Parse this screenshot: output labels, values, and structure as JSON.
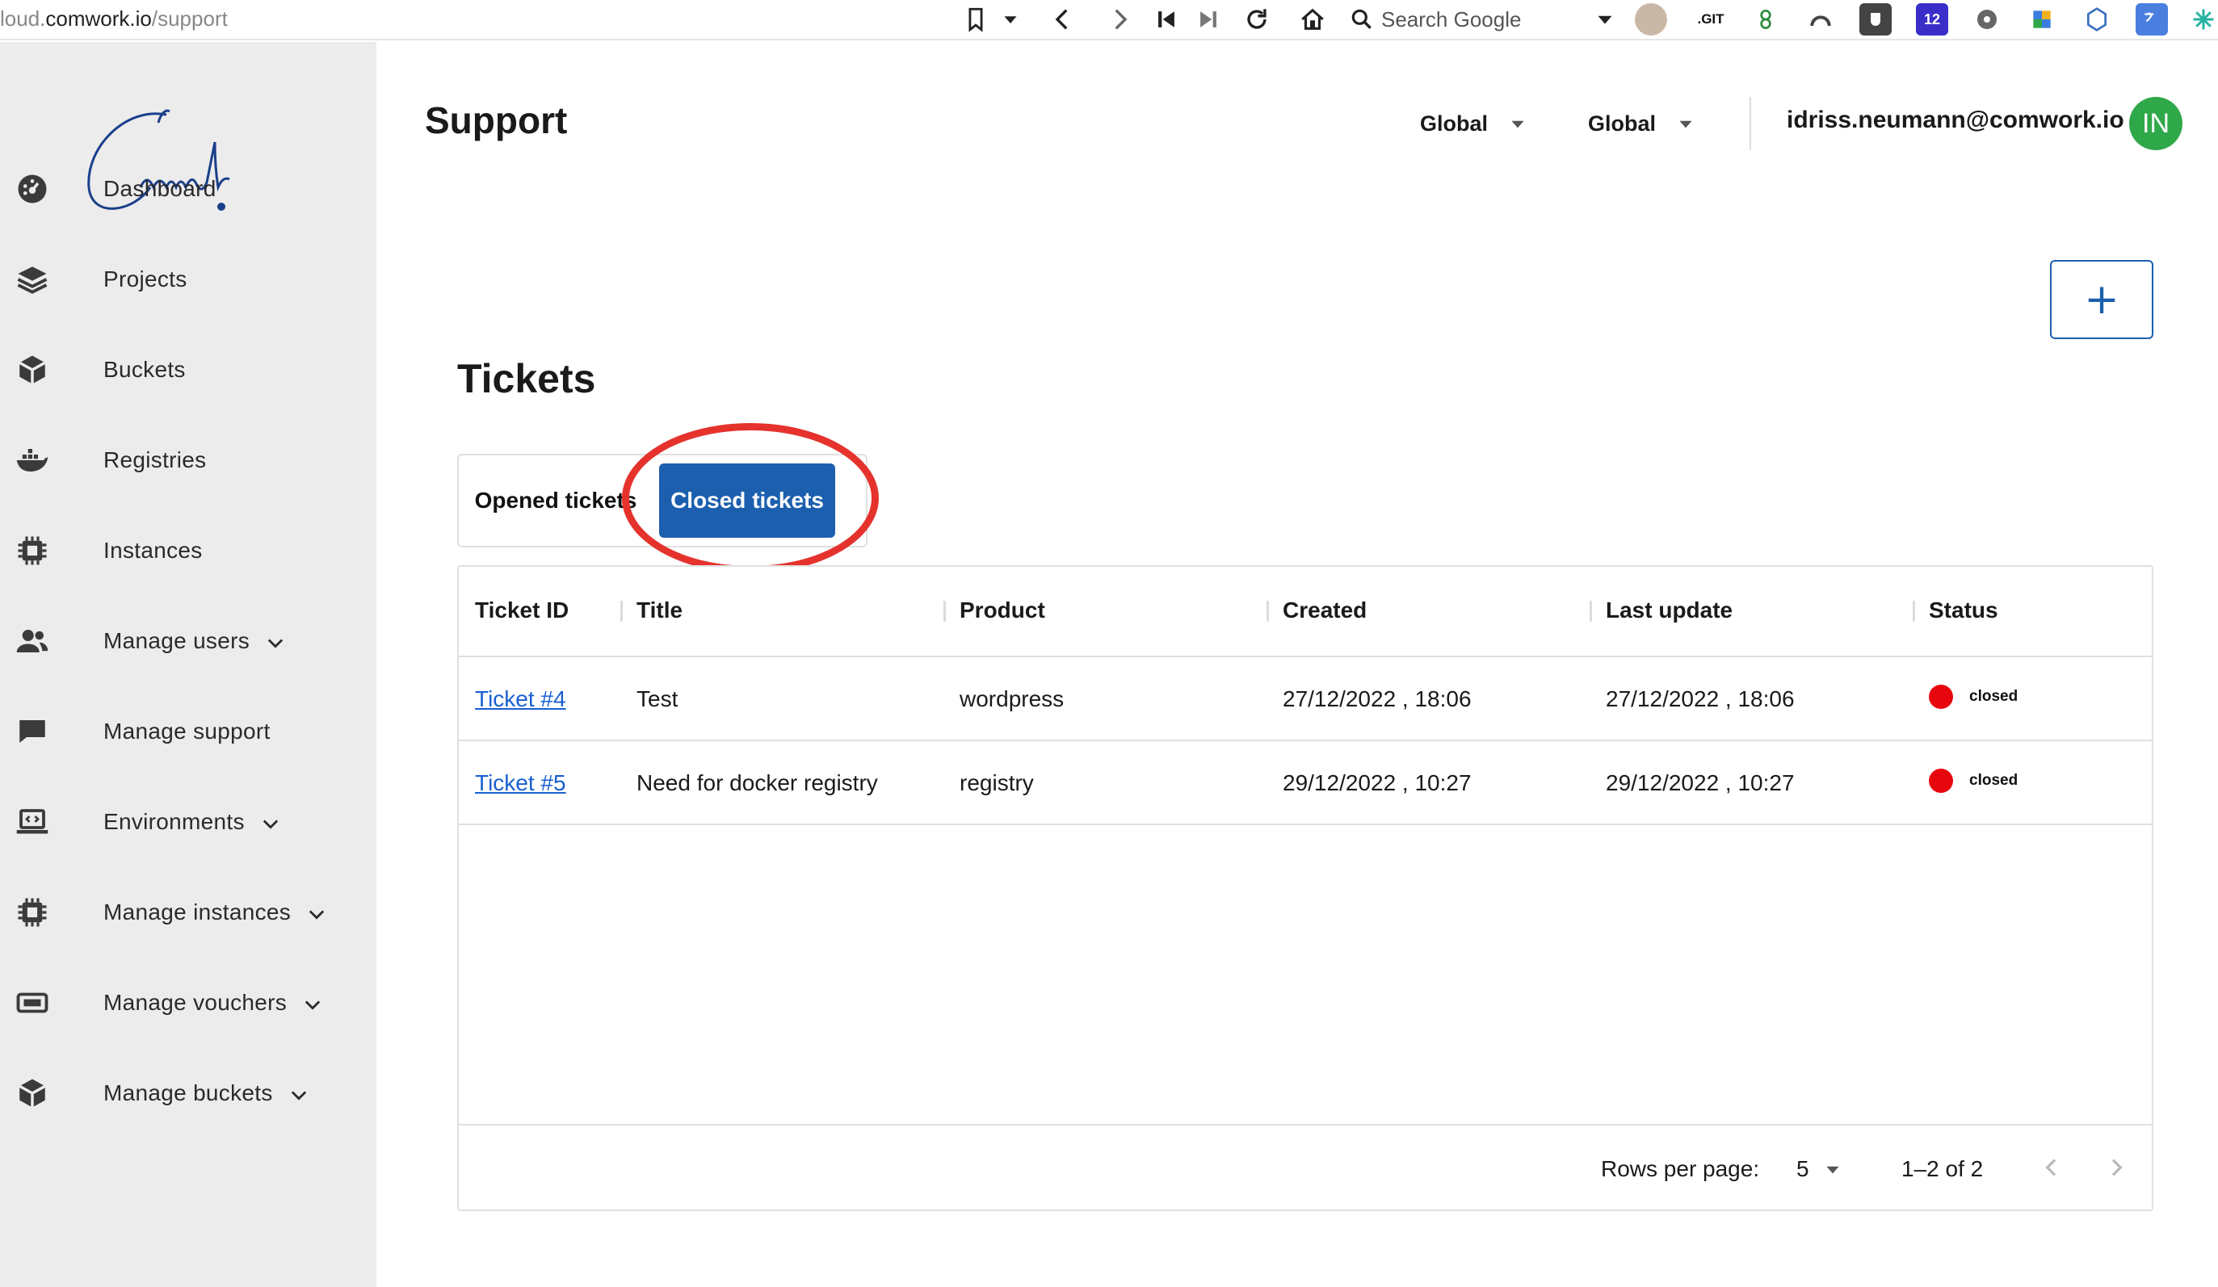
{
  "browser": {
    "url_prefix": "loud.",
    "url_host": "comwork.io",
    "url_path": "/support",
    "search_placeholder": "Search Google",
    "extension_git": ".GIT",
    "extension_badge": "12"
  },
  "sidebar": {
    "logo_text": "Comwork",
    "items": [
      {
        "label": "Dashboard",
        "icon": "dashboard-icon",
        "has_chevron": false
      },
      {
        "label": "Projects",
        "icon": "layers-icon",
        "has_chevron": false
      },
      {
        "label": "Buckets",
        "icon": "cube-icon",
        "has_chevron": false
      },
      {
        "label": "Registries",
        "icon": "docker-icon",
        "has_chevron": false
      },
      {
        "label": "Instances",
        "icon": "chip-icon",
        "has_chevron": false
      },
      {
        "label": "Manage users",
        "icon": "users-icon",
        "has_chevron": true
      },
      {
        "label": "Manage support",
        "icon": "chat-icon",
        "has_chevron": false
      },
      {
        "label": "Environments",
        "icon": "laptop-code-icon",
        "has_chevron": true
      },
      {
        "label": "Manage instances",
        "icon": "chip-icon",
        "has_chevron": true
      },
      {
        "label": "Manage vouchers",
        "icon": "ticket-icon",
        "has_chevron": true
      },
      {
        "label": "Manage buckets",
        "icon": "cube-icon",
        "has_chevron": true
      }
    ]
  },
  "header": {
    "title": "Support",
    "selector_1": "Global",
    "selector_2": "Global",
    "user_email": "idriss.neumann@comwork.io",
    "avatar_initials": "IN"
  },
  "main": {
    "add_button_label": "+",
    "section_title": "Tickets",
    "tabs": [
      {
        "label": "Opened tickets",
        "active": false
      },
      {
        "label": "Closed tickets",
        "active": true
      }
    ]
  },
  "table": {
    "columns": [
      "Ticket ID",
      "Title",
      "Product",
      "Created",
      "Last update",
      "Status"
    ],
    "rows": [
      {
        "id": "Ticket #4",
        "title": "Test",
        "product": "wordpress",
        "created": "27/12/2022 , 18:06",
        "updated": "27/12/2022 , 18:06",
        "status": "closed"
      },
      {
        "id": "Ticket #5",
        "title": "Need for docker registry",
        "product": "registry",
        "created": "29/12/2022 , 10:27",
        "updated": "29/12/2022 , 10:27",
        "status": "closed"
      }
    ],
    "footer": {
      "rows_per_page_label": "Rows per page:",
      "rows_per_page_value": "5",
      "range_label": "1–2 of 2"
    }
  },
  "colors": {
    "primary": "#1c5fae",
    "status_closed": "#e8060e",
    "annotation": "#e5322d",
    "avatar_bg": "#2fa84a",
    "sidebar_bg": "#ececec"
  }
}
